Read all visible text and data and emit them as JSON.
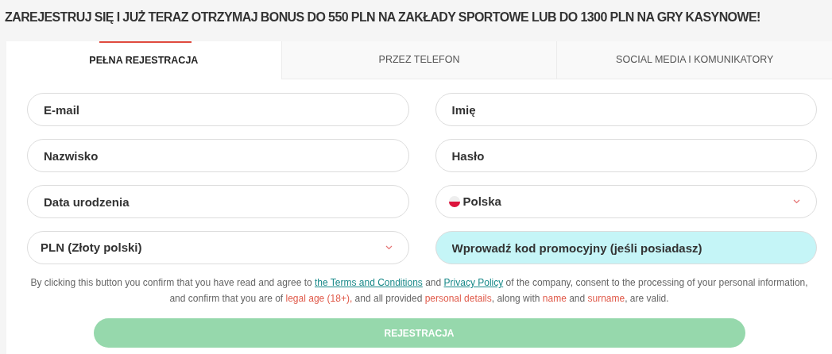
{
  "headline": "ZAREJESTRUJ SIĘ I JUŻ TERAZ OTRZYMAJ BONUS DO 550 PLN NA ZAKŁADY SPORTOWE LUB DO 1300 PLN NA GRY KASYNOWE!",
  "tabs": [
    {
      "label": "PEŁNA REJESTRACJA",
      "selected": true
    },
    {
      "label": "PRZEZ TELEFON",
      "selected": false
    },
    {
      "label": "SOCIAL MEDIA I KOMUNIKATORY",
      "selected": false
    }
  ],
  "fields": [
    {
      "kind": "input",
      "placeholder": "E-mail"
    },
    {
      "kind": "input",
      "placeholder": "Imię"
    },
    {
      "kind": "input",
      "placeholder": "Nazwisko"
    },
    {
      "kind": "input",
      "placeholder": "Hasło"
    },
    {
      "kind": "input",
      "placeholder": "Data urodzenia"
    },
    {
      "kind": "flag-select",
      "value": "Polska"
    },
    {
      "kind": "select",
      "value": "PLN (Złoty polski)"
    },
    {
      "kind": "promo",
      "placeholder": "Wprowadź kod promocyjny (jeśli posiadasz)"
    }
  ],
  "consent": [
    {
      "kind": "text",
      "text": "By clicking this button you confirm that you have read and agree to "
    },
    {
      "kind": "link",
      "text": "the Terms and Conditions"
    },
    {
      "kind": "text",
      "text": " and "
    },
    {
      "kind": "link",
      "text": "Privacy Policy"
    },
    {
      "kind": "text",
      "text": " of the company, consent to the processing of your personal information, and confirm that you are of "
    },
    {
      "kind": "highlight",
      "text": "legal age (18+),"
    },
    {
      "kind": "text",
      "text": " and all provided "
    },
    {
      "kind": "highlight",
      "text": "personal details"
    },
    {
      "kind": "text",
      "text": ", along with "
    },
    {
      "kind": "highlight",
      "text": "name"
    },
    {
      "kind": "text",
      "text": " and "
    },
    {
      "kind": "highlight",
      "text": "surname"
    },
    {
      "kind": "text",
      "text": ", are valid."
    }
  ],
  "submit": {
    "label": "REJESTRACJA",
    "disabled": true
  }
}
